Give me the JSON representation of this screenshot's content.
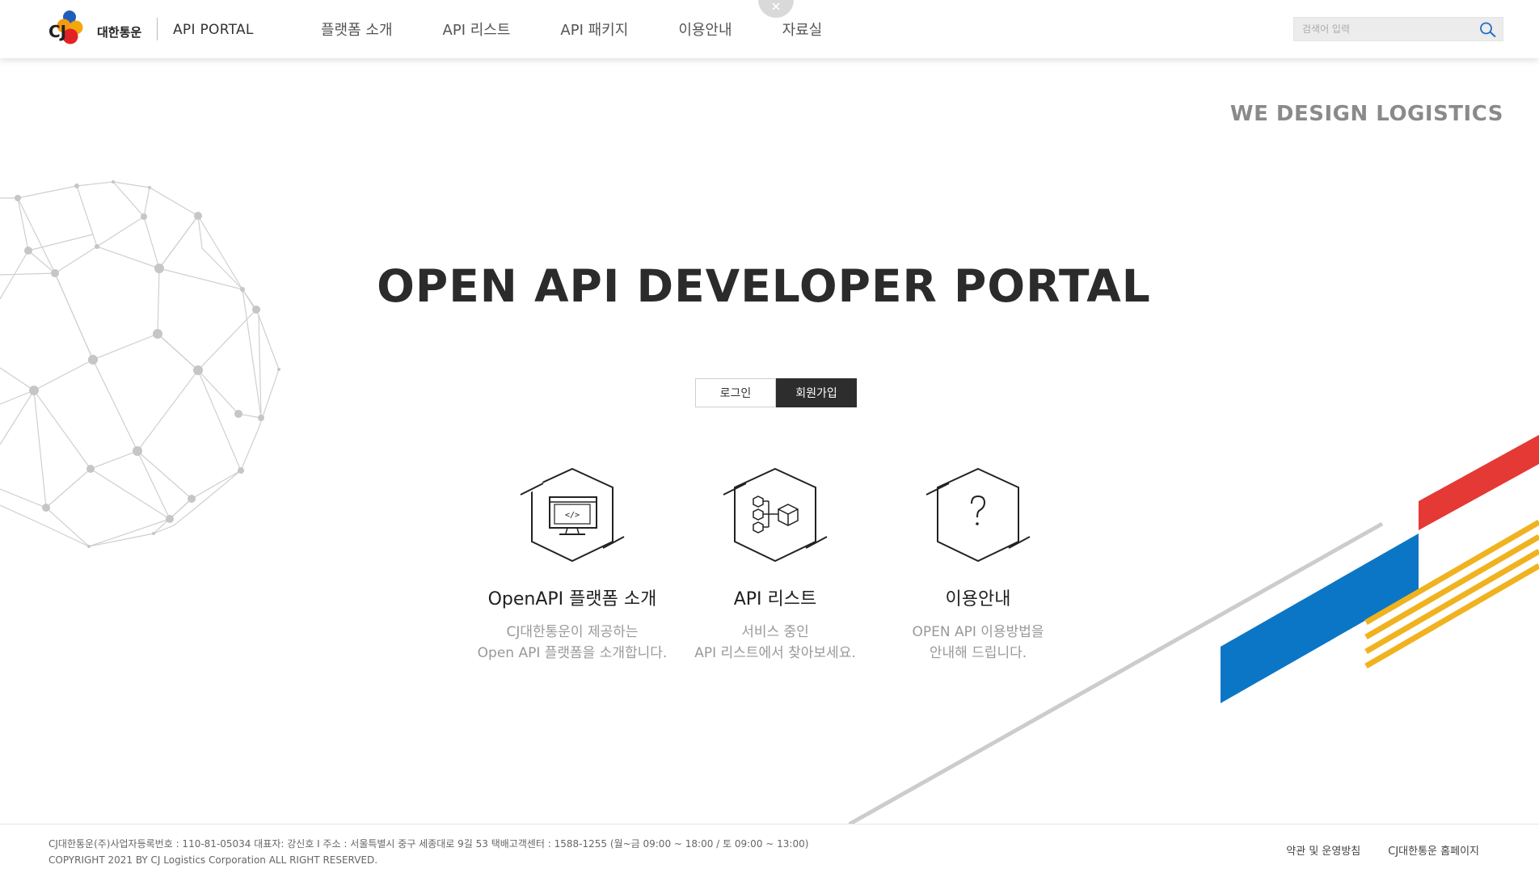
{
  "header": {
    "brand_cj": "CJ",
    "brand_korean": "대한통운",
    "portal_label": "API PORTAL",
    "nav": [
      "플랫폼 소개",
      "API 리스트",
      "API 패키지",
      "이용안내",
      "자료실"
    ],
    "search_placeholder": "검색어 입력"
  },
  "hero": {
    "slogan": "WE DESIGN LOGISTICS",
    "title": "OPEN API DEVELOPER PORTAL",
    "login_label": "로그인",
    "join_label": "회원가입"
  },
  "features": [
    {
      "title": "OpenAPI 플랫폼 소개",
      "desc_line1": "CJ대한통운이 제공하는",
      "desc_line2": "Open API 플랫폼을 소개합니다.",
      "icon": "monitor-code-icon"
    },
    {
      "title": "API 리스트",
      "desc_line1": "서비스 중인",
      "desc_line2": "API 리스트에서 찾아보세요.",
      "icon": "api-cubes-icon"
    },
    {
      "title": "이용안내",
      "desc_line1": "OPEN API 이용방법을",
      "desc_line2": "안내해 드립니다.",
      "icon": "question-icon"
    }
  ],
  "footer": {
    "info_line1": "CJ대한통운(주)사업자등록번호 : 110-81-05034 대표자: 강신호 I 주소 : 서울특별시 중구 세종대로 9길 53 택배고객센터 : 1588-1255 (월~금 09:00 ~ 18:00 / 토 09:00 ~ 13:00)",
    "info_line2": "COPYRIGHT 2021 BY CJ Logistics Corporation ALL RIGHT RESERVED.",
    "links": [
      "약관 및 운영방침",
      "CJ대한통운 홈페이지"
    ]
  },
  "colors": {
    "stripe_red": "#e53935",
    "stripe_blue": "#0b76c5",
    "stripe_yellow": "#f0b21e",
    "dark_button": "#2d2d2d"
  }
}
